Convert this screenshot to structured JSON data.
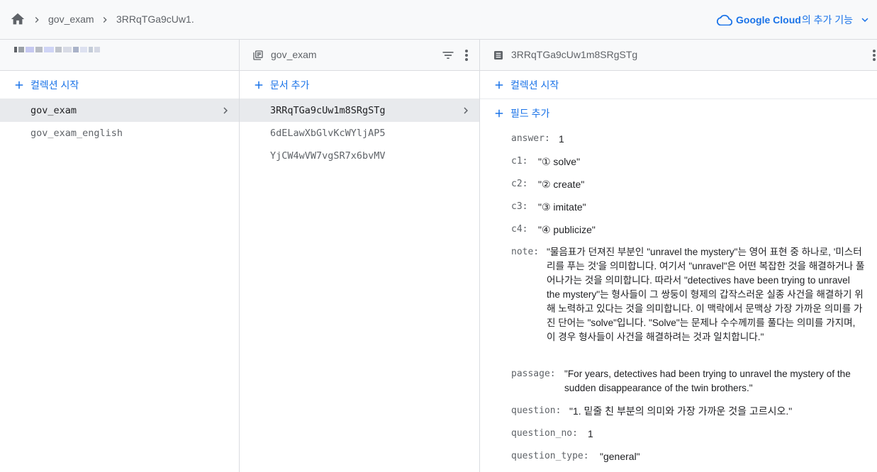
{
  "breadcrumb": {
    "home_icon": "home-icon",
    "items": [
      "gov_exam",
      "3RRqTGa9cUw1."
    ]
  },
  "google_cloud": {
    "name": "Google Cloud",
    "suffix": "의 추가 기능",
    "icon": "cloud-icon",
    "accent": "#1a73e8"
  },
  "panel_root": {
    "start_collection_label": "컬렉션 시작",
    "collections": [
      "gov_exam",
      "gov_exam_english"
    ],
    "selected_index": 0
  },
  "panel_collection": {
    "title": "gov_exam",
    "add_document_label": "문서 추가",
    "documents": [
      "3RRqTGa9cUw1m8SRgSTg",
      "6dELawXbGlvKcWYljAP5",
      "YjCW4wVW7vgSR7x6bvMV"
    ],
    "selected_index": 0
  },
  "panel_document": {
    "title": "3RRqTGa9cUw1m8SRgSTg",
    "start_collection_label": "컬렉션 시작",
    "add_field_label": "필드 추가",
    "fields": {
      "answer": {
        "key": "answer:",
        "value": "1"
      },
      "c1": {
        "key": "c1:",
        "value": "\"① solve\""
      },
      "c2": {
        "key": "c2:",
        "value": "\"② create\""
      },
      "c3": {
        "key": "c3:",
        "value": "\"③ imitate\""
      },
      "c4": {
        "key": "c4:",
        "value": "\"④ publicize\""
      },
      "note": {
        "key": "note:",
        "value": "\"물음표가 던져진 부분인 \"unravel the mystery\"는 영어 표현 중 하나로, '미스터리를 푸는 것'을 의미합니다. 여기서 \"unravel\"은 어떤 복잡한 것을 해결하거나 풀어나가는 것을 의미합니다. 따라서 \"detectives have been trying to unravel the mystery\"는 형사들이 그 쌍둥이 형제의 갑작스러운 실종 사건을 해결하기 위해 노력하고 있다는 것을 의미합니다. 이 맥락에서 문맥상 가장 가까운 의미를 가진 단어는 \"solve\"입니다. \"Solve\"는 문제나 수수께끼를 풀다는 의미를 가지며, 이 경우 형사들이 사건을 해결하려는 것과 일치합니다.\""
      },
      "passage": {
        "key": "passage:",
        "value": "\"For years, detectives had been trying to unravel the mystery of the sudden disappearance of the twin brothers.\""
      },
      "question": {
        "key": "question:",
        "value": "\"1. 밑줄 친 부분의 의미와 가장 가까운 것을 고르시오.\""
      },
      "question_no": {
        "key": "question_no:",
        "value": "1"
      },
      "question_type": {
        "key": "question_type:",
        "value": "\"general\""
      }
    }
  }
}
